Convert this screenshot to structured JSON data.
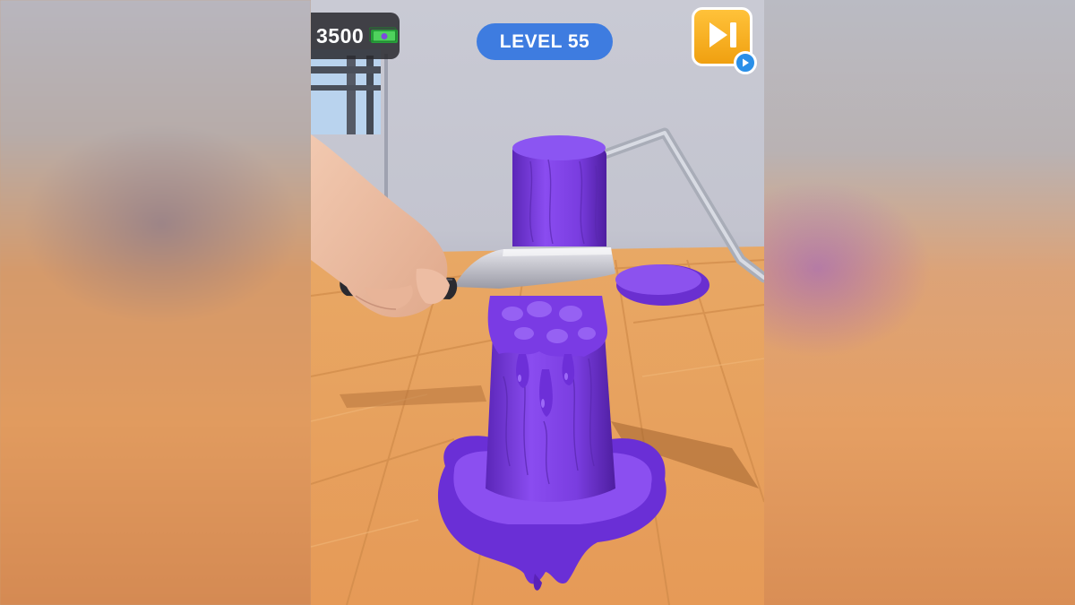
{
  "hud": {
    "money_amount": "3500",
    "money_icon": "cash-icon",
    "level_label": "LEVEL 55",
    "skip_icon": "skip-level-icon",
    "ad_icon": "video-ad-icon"
  },
  "colors": {
    "slime": "#7b3fe0",
    "slime_dark": "#5a22b8",
    "floor": "#e9a15f",
    "level_pill": "#3e7ce0",
    "skip_button": "#f5a91c"
  }
}
